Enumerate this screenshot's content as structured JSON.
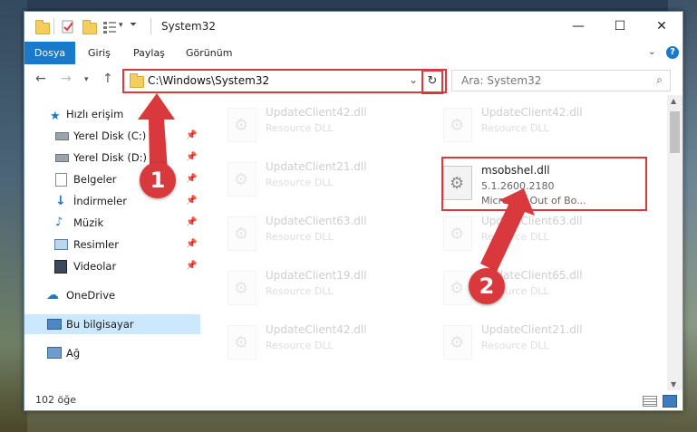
{
  "window": {
    "title": "System32",
    "controls": {
      "minimize": "—",
      "maximize": "☐",
      "close": "✕"
    }
  },
  "ribbon": {
    "tabs": [
      "Dosya",
      "Giriş",
      "Paylaş",
      "Görünüm"
    ],
    "help": "?"
  },
  "navigation": {
    "address": "C:\\Windows\\System32",
    "search_placeholder": "Ara: System32"
  },
  "sidebar": {
    "items": [
      {
        "label": "Hızlı erişim",
        "icon": "star-icon"
      },
      {
        "label": "Yerel Disk (C:)",
        "icon": "drive-icon",
        "pinned": true
      },
      {
        "label": "Yerel Disk (D:)",
        "icon": "drive-icon",
        "pinned": true
      },
      {
        "label": "Belgeler",
        "icon": "documents-icon",
        "pinned": true
      },
      {
        "label": "İndirmeler",
        "icon": "download-icon",
        "pinned": true
      },
      {
        "label": "Müzik",
        "icon": "music-icon",
        "pinned": true
      },
      {
        "label": "Resimler",
        "icon": "pictures-icon",
        "pinned": true
      },
      {
        "label": "Videolar",
        "icon": "video-icon",
        "pinned": true
      },
      {
        "label": "OneDrive",
        "icon": "cloud-icon"
      },
      {
        "label": "Bu bilgisayar",
        "icon": "computer-icon",
        "selected": true
      },
      {
        "label": "Ağ",
        "icon": "network-icon"
      }
    ]
  },
  "files": {
    "left": [
      {
        "name": "UpdateClient42.dll",
        "desc": "Resource DLL"
      },
      {
        "name": "UpdateClient21.dll",
        "desc": "Resource DLL"
      },
      {
        "name": "UpdateClient63.dll",
        "desc": "Resource DLL"
      },
      {
        "name": "UpdateClient19.dll",
        "desc": "Resource DLL"
      },
      {
        "name": "UpdateClient42.dll",
        "desc": "Resource DLL"
      }
    ],
    "right": [
      {
        "name": "UpdateClient42.dll",
        "desc": "Resource DLL"
      },
      {
        "name": "UpdateClient63.dll",
        "desc": "Resource DLL"
      },
      {
        "name": "UpdateClient65.dll",
        "desc": "Resource DLL"
      },
      {
        "name": "UpdateClient21.dll",
        "desc": "Resource DLL"
      }
    ],
    "highlighted": {
      "name": "msobshel.dll",
      "version": "5.1.2600.2180",
      "desc": "Microsoft Out of Bo..."
    }
  },
  "status": {
    "count": "102 öğe"
  },
  "markers": {
    "one": "1",
    "two": "2"
  },
  "colors": {
    "accent": "#1979ca",
    "highlight": "#d9393c"
  }
}
